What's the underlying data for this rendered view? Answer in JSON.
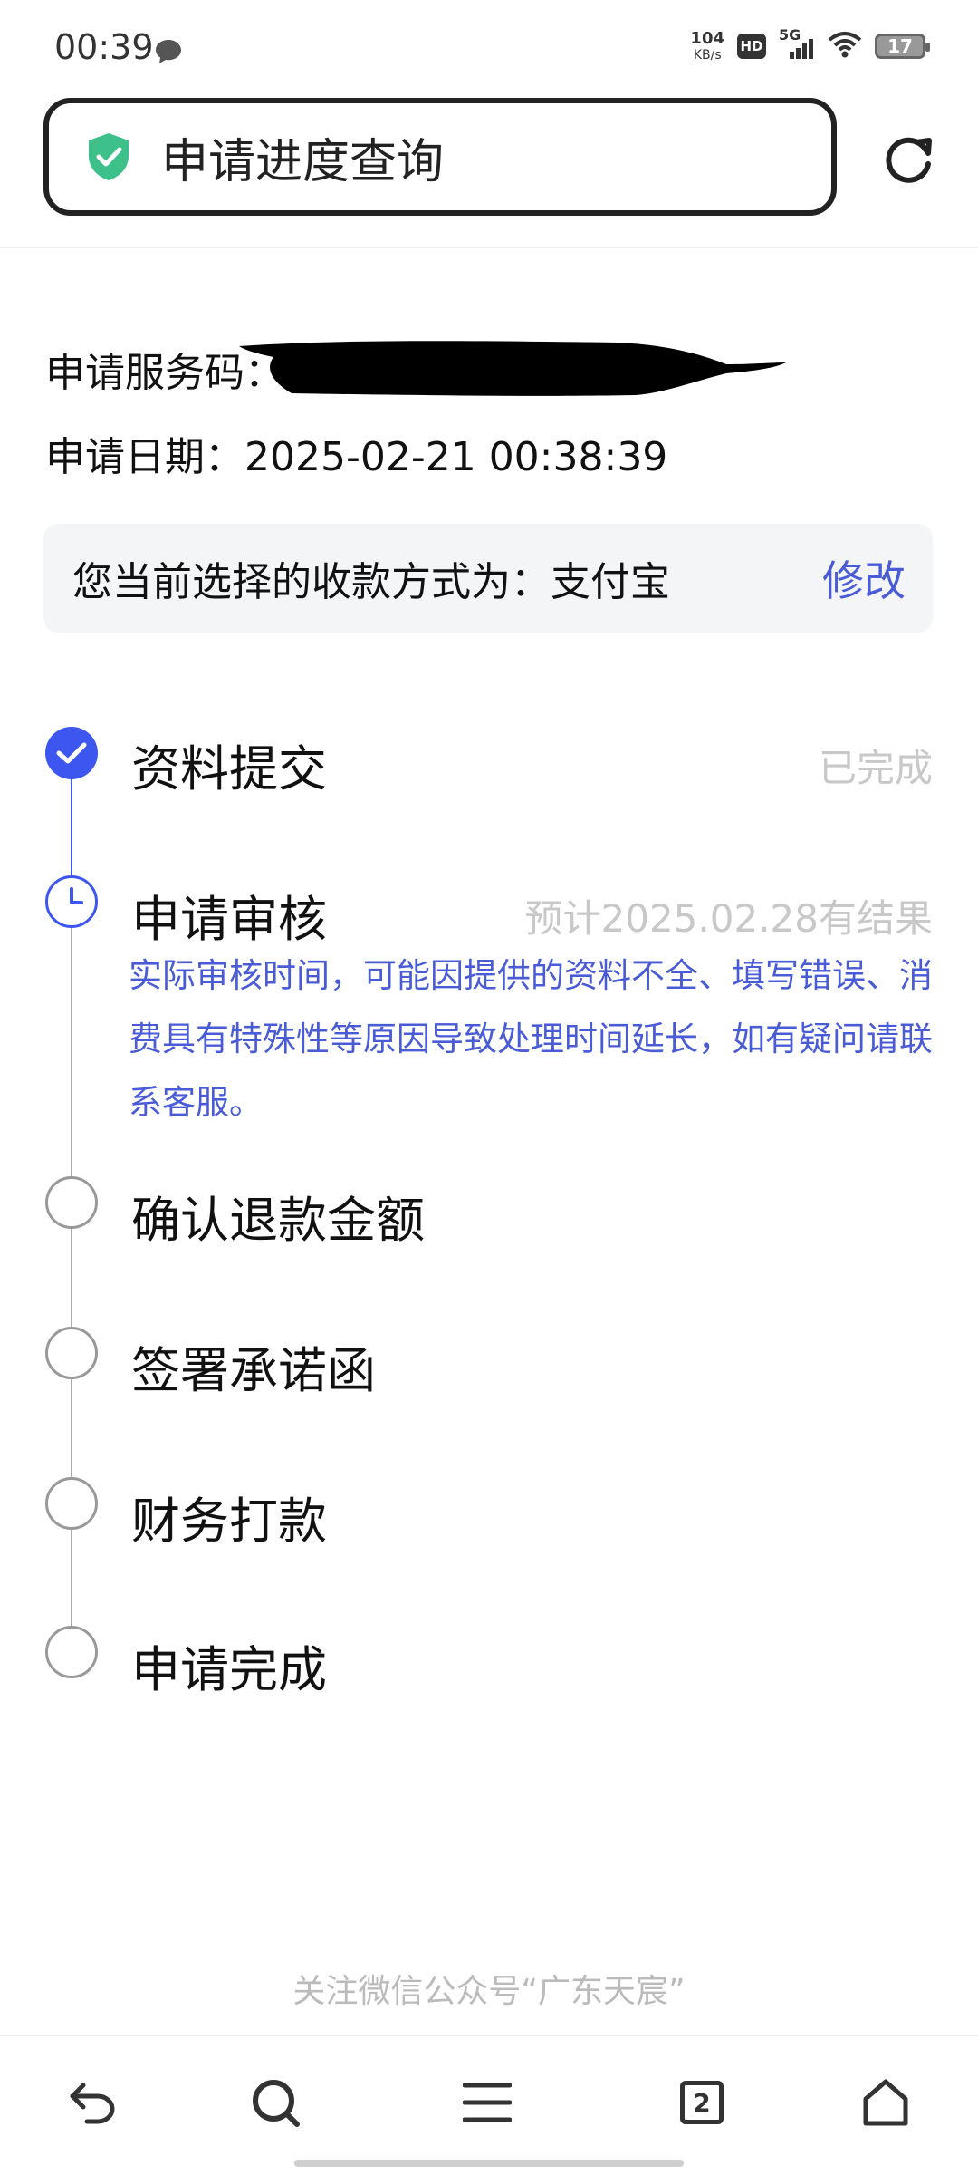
{
  "status_bar": {
    "time": "00:39",
    "net_speed_value": "104",
    "net_speed_unit": "KB/s",
    "hd": "HD",
    "network": "5G",
    "battery": "17"
  },
  "header": {
    "title": "申请进度查询"
  },
  "info": {
    "service_code_label": "申请服务码：",
    "service_code_value": "",
    "date_text": "申请日期：2025-02-21 00:38:39"
  },
  "payment": {
    "text": "您当前选择的收款方式为：支付宝",
    "edit_label": "修改"
  },
  "steps": [
    {
      "label": "资料提交",
      "status": "已完成",
      "state": "done"
    },
    {
      "label": "申请审核",
      "status": "预计2025.02.28有结果",
      "state": "current",
      "note": "实际审核时间，可能因提供的资料不全、填写错误、消费具有特殊性等原因导致处理时间延长，如有疑问请联系客服。"
    },
    {
      "label": "确认退款金额",
      "status": "",
      "state": "todo"
    },
    {
      "label": "签署承诺函",
      "status": "",
      "state": "todo"
    },
    {
      "label": "财务打款",
      "status": "",
      "state": "todo"
    },
    {
      "label": "申请完成",
      "status": "",
      "state": "todo"
    }
  ],
  "footer": {
    "text": "关注微信公众号“广东天宸”"
  },
  "bottom_nav": {
    "tabs_count": "2",
    "icons": [
      "back-icon",
      "search-icon",
      "menu-icon",
      "tabs-icon",
      "home-icon"
    ]
  },
  "colors": {
    "accent": "#3d56ef",
    "note_blue": "#4a5bd6",
    "shield_green": "#3ec08a",
    "muted": "#c8c8c8"
  }
}
